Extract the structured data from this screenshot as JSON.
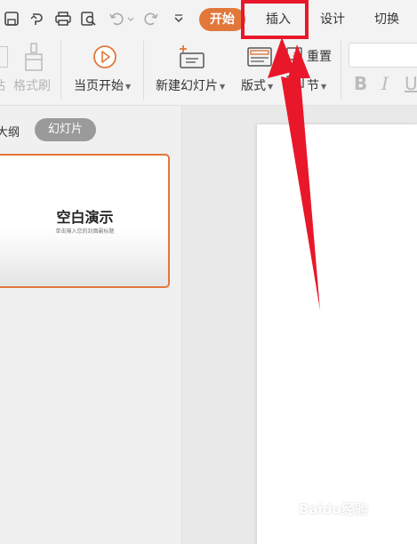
{
  "tabs": {
    "home": "开始",
    "insert": "插入",
    "design": "设计",
    "transition": "切换"
  },
  "ribbon": {
    "format_painter": "格式刷",
    "play_current": "当页开始",
    "new_slide": "新建幻灯片",
    "layout": "版式",
    "reset": "重置",
    "section": "节",
    "bold": "B",
    "italic": "I",
    "underline": "U",
    "font_name": "",
    "partial_left_label": "粘"
  },
  "left_pane": {
    "outline_tab": "大纲",
    "slides_tab": "幻灯片",
    "thumbnail_title": "空白演示",
    "thumbnail_subtitle": "单击输入您的封面副标题"
  },
  "watermark": "Baidu经验",
  "colors": {
    "accent": "#e2773a",
    "annotation": "#e8182a",
    "play_icon": "#e2773a"
  }
}
